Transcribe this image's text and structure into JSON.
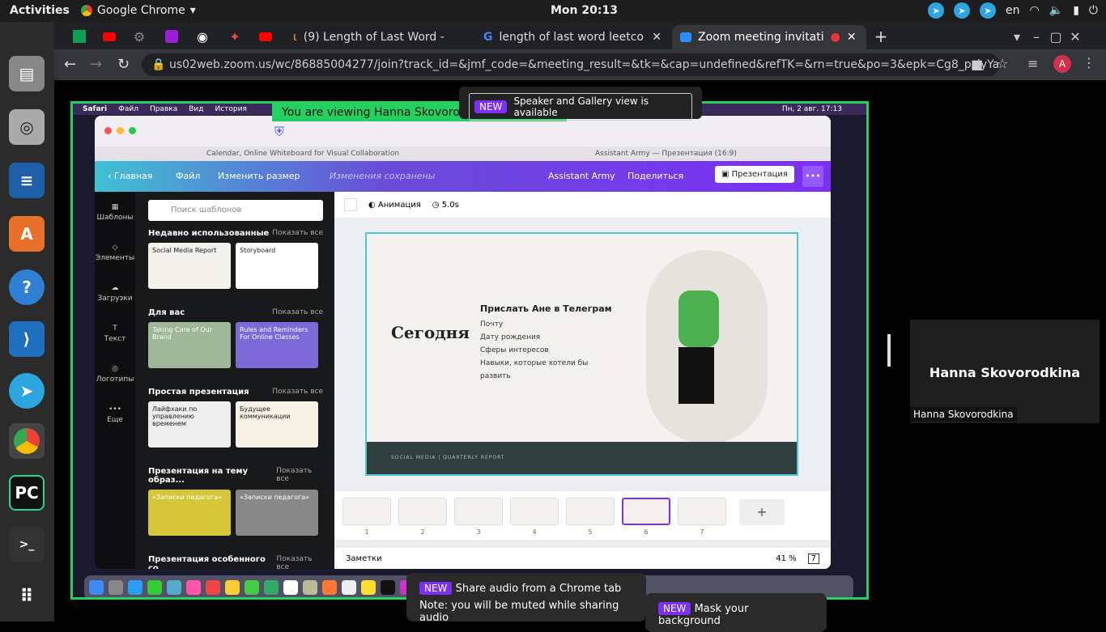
{
  "topbar": {
    "activities": "Activities",
    "app": "Google Chrome",
    "clock": "Mon 20:13",
    "lang": "en"
  },
  "tabs": [
    {
      "title": "(9) Length of Last Word - "
    },
    {
      "title": "length of last word leetco"
    },
    {
      "title": "Zoom meeting invitati"
    }
  ],
  "address": {
    "url": "us02web.zoom.us/wc/86885004277/join?track_id=&jmf_code=&meeting_result=&tk=&cap=undefined&refTK=&rn=true&po=3&epk=Cg8_pslyYaON7Sea…",
    "profile": "A"
  },
  "mac": {
    "menu": [
      "Safari",
      "Файл",
      "Правка",
      "Вид",
      "История"
    ],
    "status_time": "Пн, 2 авг. 17:13",
    "safari_tab1": "Calendar, Online Whiteboard for Visual Collaboration",
    "safari_tab2": "Assistant Army — Презентация (16:9)"
  },
  "canva": {
    "home": "Главная",
    "file": "Файл",
    "resize": "Изменить размер",
    "saved": "Изменения сохранены",
    "team": "Assistant Army",
    "share": "Поделиться",
    "present": "Презентация",
    "side": [
      "Шаблоны",
      "Элементы",
      "Загрузки",
      "Текст",
      "Логотипы",
      "Еще"
    ],
    "search_ph": "Поиск шаблонов",
    "sections": [
      {
        "title": "Недавно использованные",
        "all": "Показать все",
        "t1": "Social Media Report",
        "t2": "Storyboard"
      },
      {
        "title": "Для вас",
        "all": "Показать все",
        "t1": "Taking Care of Our Brand",
        "t2": "Rules and Reminders For Online Classes"
      },
      {
        "title": "Простая презентация",
        "all": "Показать все",
        "t1": "Лайфхаки по управлению временем",
        "t2": "Будущее коммуникации"
      },
      {
        "title": "Презентация на тему образ...",
        "all": "Показать все",
        "t1": "«Записки педагога»",
        "t2": "«Записки педагога»"
      },
      {
        "title": "Презентация особенного со...",
        "all": "Показать все"
      }
    ],
    "anim": "Анимация",
    "dur": "5.0s",
    "slide": {
      "today": "Сегодня",
      "send": "Прислать Ане в Телеграм",
      "items": [
        "Почту",
        "Дату рождения",
        "Сферы интересов",
        "Навыки, которые хотели бы развить"
      ],
      "footer": "SOCIAL MEDIA | QUARTERLY REPORT"
    },
    "pages": [
      "1",
      "2",
      "3",
      "4",
      "5",
      "6",
      "7"
    ],
    "notes": "Заметки",
    "zoom": "41 %",
    "pagecount": "7"
  },
  "zoom": {
    "viewing": "You are viewing Hanna Skovoro",
    "new": "NEW",
    "speaker": "Speaker and Gallery view is available",
    "participant": "Hanna Skovorodkina",
    "pop1_a": "Share audio from a Chrome tab",
    "pop1_b": "Note: you will be muted while sharing audio",
    "pop2": "Mask your background"
  },
  "colors": {
    "green_border": "#23d160",
    "new_badge": "#7b2ff7"
  }
}
